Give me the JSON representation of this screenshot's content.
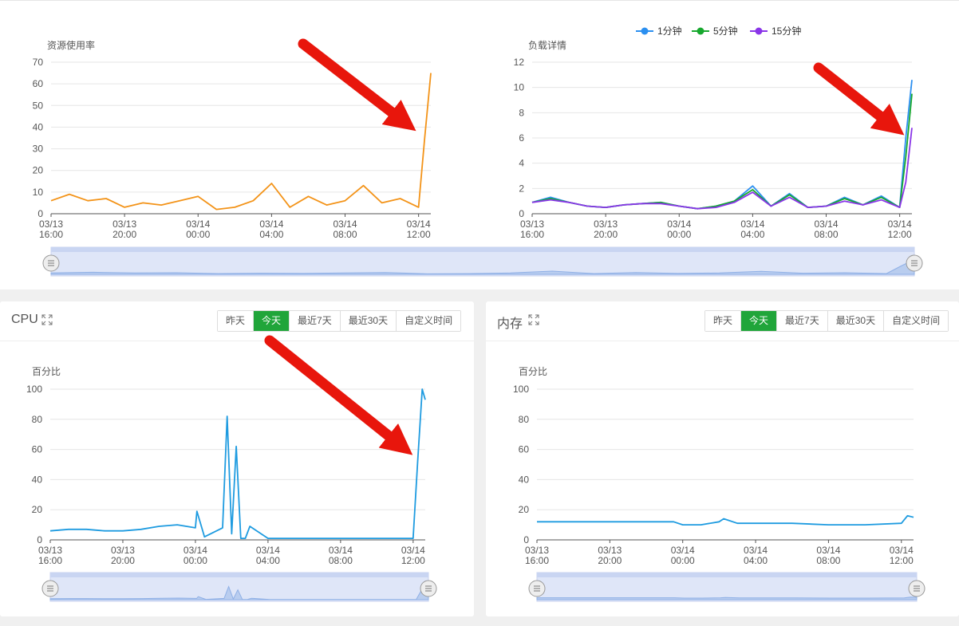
{
  "top": {
    "resource_chart": {
      "type": "line",
      "title": "资源使用率",
      "y_ticks": [
        "0",
        "10",
        "20",
        "30",
        "40",
        "50",
        "60",
        "70"
      ],
      "ylim": [
        0,
        70
      ],
      "x_ticks": [
        [
          "03/13",
          "16:00"
        ],
        [
          "03/13",
          "20:00"
        ],
        [
          "03/14",
          "00:00"
        ],
        [
          "03/14",
          "04:00"
        ],
        [
          "03/14",
          "08:00"
        ],
        [
          "03/14",
          "12:00"
        ]
      ],
      "color": "#f39318"
    },
    "load_chart": {
      "type": "line",
      "title": "负载详情",
      "y_ticks": [
        "0",
        "2",
        "4",
        "6",
        "8",
        "10",
        "12"
      ],
      "ylim": [
        0,
        12
      ],
      "x_ticks": [
        [
          "03/13",
          "16:00"
        ],
        [
          "03/13",
          "20:00"
        ],
        [
          "03/14",
          "00:00"
        ],
        [
          "03/14",
          "04:00"
        ],
        [
          "03/14",
          "08:00"
        ],
        [
          "03/14",
          "12:00"
        ]
      ],
      "legend": [
        {
          "name": "1分钟",
          "color": "#2b8ff0"
        },
        {
          "name": "5分钟",
          "color": "#17a82e"
        },
        {
          "name": "15分钟",
          "color": "#8a35e8"
        }
      ]
    }
  },
  "cpu": {
    "title": "CPU",
    "buttons": [
      "昨天",
      "今天",
      "最近7天",
      "最近30天",
      "自定义时间"
    ],
    "active": 1,
    "chart": {
      "type": "line",
      "ylabel": "百分比",
      "y_ticks": [
        "0",
        "20",
        "40",
        "60",
        "80",
        "100"
      ],
      "ylim": [
        0,
        100
      ],
      "x_ticks": [
        [
          "03/13",
          "16:00"
        ],
        [
          "03/13",
          "20:00"
        ],
        [
          "03/14",
          "00:00"
        ],
        [
          "03/14",
          "04:00"
        ],
        [
          "03/14",
          "08:00"
        ],
        [
          "03/14",
          "12:00"
        ]
      ],
      "color": "#1e9be0"
    }
  },
  "memory": {
    "title": "内存",
    "buttons": [
      "昨天",
      "今天",
      "最近7天",
      "最近30天",
      "自定义时间"
    ],
    "active": 1,
    "chart": {
      "type": "line",
      "ylabel": "百分比",
      "y_ticks": [
        "0",
        "20",
        "40",
        "60",
        "80",
        "100"
      ],
      "ylim": [
        0,
        100
      ],
      "x_ticks": [
        [
          "03/13",
          "16:00"
        ],
        [
          "03/13",
          "20:00"
        ],
        [
          "03/14",
          "00:00"
        ],
        [
          "03/14",
          "04:00"
        ],
        [
          "03/14",
          "08:00"
        ],
        [
          "03/14",
          "12:00"
        ]
      ],
      "color": "#1e9be0"
    }
  },
  "chart_data": [
    {
      "type": "line",
      "title": "资源使用率",
      "ylim": [
        0,
        70
      ],
      "x": [
        "03/13 16:00",
        "03/13 17:00",
        "03/13 18:00",
        "03/13 19:00",
        "03/13 20:00",
        "03/13 21:00",
        "03/13 22:00",
        "03/13 23:00",
        "03/14 00:00",
        "03/14 01:00",
        "03/14 02:00",
        "03/14 03:00",
        "03/14 04:00",
        "03/14 05:00",
        "03/14 06:00",
        "03/14 07:00",
        "03/14 08:00",
        "03/14 09:00",
        "03/14 10:00",
        "03/14 11:00",
        "03/14 12:00",
        "03/14 12:20",
        "03/14 12:40"
      ],
      "series": [
        {
          "values": [
            6,
            9,
            6,
            7,
            3,
            5,
            4,
            6,
            8,
            2,
            3,
            6,
            14,
            3,
            8,
            4,
            6,
            13,
            5,
            7,
            3,
            35,
            65
          ]
        }
      ]
    },
    {
      "type": "line",
      "title": "负载详情",
      "ylim": [
        0,
        12
      ],
      "x": [
        "03/13 16:00",
        "03/13 17:00",
        "03/13 18:00",
        "03/13 19:00",
        "03/13 20:00",
        "03/13 21:00",
        "03/13 22:00",
        "03/13 23:00",
        "03/14 00:00",
        "03/14 01:00",
        "03/14 02:00",
        "03/14 03:00",
        "03/14 04:00",
        "03/14 05:00",
        "03/14 06:00",
        "03/14 07:00",
        "03/14 08:00",
        "03/14 09:00",
        "03/14 10:00",
        "03/14 11:00",
        "03/14 12:00",
        "03/14 12:20",
        "03/14 12:40"
      ],
      "series": [
        {
          "name": "1分钟",
          "values": [
            0.9,
            1.3,
            0.9,
            0.6,
            0.5,
            0.7,
            0.8,
            0.9,
            0.6,
            0.4,
            0.6,
            1.0,
            2.2,
            0.6,
            1.6,
            0.5,
            0.6,
            1.3,
            0.7,
            1.4,
            0.5,
            6.0,
            10.6
          ]
        },
        {
          "name": "5分钟",
          "values": [
            0.9,
            1.2,
            0.9,
            0.6,
            0.5,
            0.7,
            0.8,
            0.9,
            0.6,
            0.4,
            0.6,
            1.0,
            1.9,
            0.6,
            1.5,
            0.5,
            0.6,
            1.2,
            0.7,
            1.3,
            0.5,
            4.5,
            9.5
          ]
        },
        {
          "name": "15分钟",
          "values": [
            0.9,
            1.1,
            0.9,
            0.6,
            0.5,
            0.7,
            0.8,
            0.8,
            0.6,
            0.4,
            0.5,
            0.9,
            1.7,
            0.6,
            1.3,
            0.5,
            0.6,
            1.0,
            0.7,
            1.1,
            0.5,
            2.5,
            6.8
          ]
        }
      ]
    },
    {
      "type": "line",
      "title": "CPU",
      "ylabel": "百分比",
      "ylim": [
        0,
        100
      ],
      "x": [
        "03/13 16:00",
        "03/13 17:00",
        "03/13 18:00",
        "03/13 19:00",
        "03/13 20:00",
        "03/13 21:00",
        "03/13 22:00",
        "03/13 23:00",
        "03/14 00:00",
        "03/14 00:05",
        "03/14 00:30",
        "03/14 01:30",
        "03/14 01:45",
        "03/14 02:00",
        "03/14 02:15",
        "03/14 02:30",
        "03/14 02:45",
        "03/14 03:00",
        "03/14 04:00",
        "03/14 05:00",
        "03/14 06:00",
        "03/14 08:00",
        "03/14 10:00",
        "03/14 12:00",
        "03/14 12:15",
        "03/14 12:30",
        "03/14 12:40"
      ],
      "series": [
        {
          "values": [
            6,
            7,
            7,
            6,
            6,
            7,
            9,
            10,
            8,
            19,
            2,
            8,
            82,
            4,
            62,
            1,
            1,
            9,
            1,
            1,
            1,
            1,
            1,
            1,
            52,
            100,
            93
          ]
        }
      ]
    },
    {
      "type": "line",
      "title": "内存",
      "ylabel": "百分比",
      "ylim": [
        0,
        100
      ],
      "x": [
        "03/13 16:00",
        "03/13 18:00",
        "03/13 20:00",
        "03/13 22:00",
        "03/13 23:30",
        "03/14 00:00",
        "03/14 01:00",
        "03/14 02:00",
        "03/14 02:15",
        "03/14 03:00",
        "03/14 04:00",
        "03/14 06:00",
        "03/14 08:00",
        "03/14 10:00",
        "03/14 12:00",
        "03/14 12:20",
        "03/14 12:40"
      ],
      "series": [
        {
          "values": [
            12,
            12,
            12,
            12,
            12,
            10,
            10,
            12,
            14,
            11,
            11,
            11,
            10,
            10,
            11,
            16,
            15
          ]
        }
      ]
    }
  ]
}
